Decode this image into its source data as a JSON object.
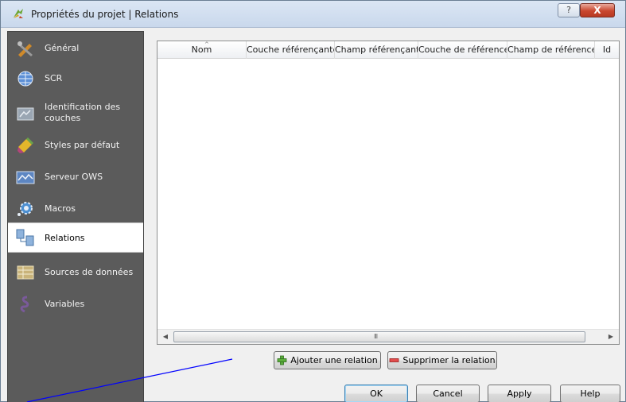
{
  "window": {
    "title": "Propriétés du projet | Relations",
    "help_label": "?",
    "close_label": "X"
  },
  "sidebar": {
    "items": [
      {
        "label": "Général",
        "icon": "tools-icon"
      },
      {
        "label": "SCR",
        "icon": "globe-icon"
      },
      {
        "label": "Identification des couches",
        "icon": "identify-layers-icon"
      },
      {
        "label": "Styles par défaut",
        "icon": "styles-brush-icon"
      },
      {
        "label": "Serveur OWS",
        "icon": "ows-server-icon"
      },
      {
        "label": "Macros",
        "icon": "macros-gear-icon"
      },
      {
        "label": "Relations",
        "icon": "relations-icon",
        "selected": true
      },
      {
        "label": "Sources de données",
        "icon": "data-sources-icon"
      },
      {
        "label": "Variables",
        "icon": "variables-icon"
      }
    ]
  },
  "table": {
    "columns": [
      "Nom",
      "Couche référençante",
      "Champ référençant",
      "Couche de référence",
      "Champ de référence",
      "Id"
    ],
    "rows": [],
    "scrollbar_grip": "III"
  },
  "actions": {
    "add_relation": "Ajouter une relation",
    "remove_relation": "Supprimer la relation"
  },
  "buttons": {
    "ok": "OK",
    "cancel": "Cancel",
    "apply": "Apply",
    "help": "Help"
  },
  "colors": {
    "sidebar_bg": "#5b5b5b",
    "selected_bg": "#ffffff",
    "annotation_line": "#0000ff",
    "close_button": "#c9462e"
  }
}
